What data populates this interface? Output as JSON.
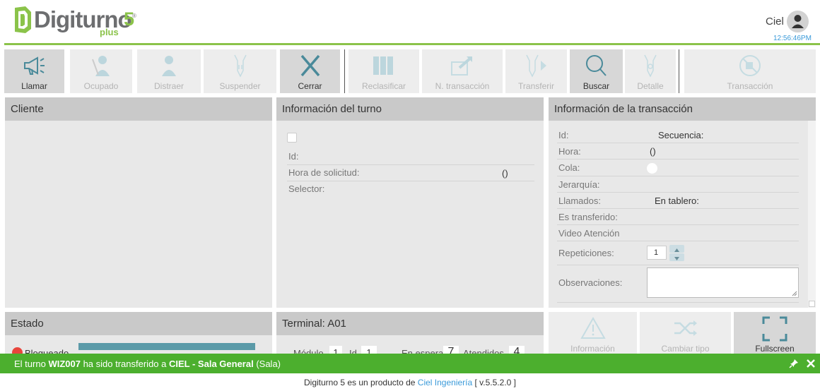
{
  "header": {
    "logo_word": "Digiturno",
    "logo_number": "5",
    "logo_reg": "®",
    "logo_plus": "plus",
    "user_name": "Ciel",
    "clock": "12:56:46PM"
  },
  "toolbar": [
    {
      "label": "Llamar",
      "icon": "megaphone-icon",
      "enabled": true
    },
    {
      "label": "Ocupado",
      "icon": "busy-user-icon",
      "enabled": false
    },
    {
      "label": "Distraer",
      "icon": "user-icon",
      "enabled": false
    },
    {
      "label": "Suspender",
      "icon": "pause-tag-icon",
      "enabled": false
    },
    {
      "label": "Cerrar",
      "icon": "close-icon",
      "enabled": true
    },
    {
      "label": "Reclasificar",
      "icon": "binders-icon",
      "enabled": false
    },
    {
      "label": "N. transacción",
      "icon": "export-icon",
      "enabled": false
    },
    {
      "label": "Transferir",
      "icon": "transfer-tag-icon",
      "enabled": false
    },
    {
      "label": "Buscar",
      "icon": "search-icon",
      "enabled": true
    },
    {
      "label": "Detalle",
      "icon": "detail-tag-icon",
      "enabled": false
    },
    {
      "label": "Transacción",
      "icon": "no-transaction-icon",
      "enabled": false
    }
  ],
  "cliente": {
    "title": "Cliente"
  },
  "turno": {
    "title": "Información del turno",
    "id_label": "Id:",
    "hora_label": "Hora de solicitud:",
    "hora_value": "()",
    "selector_label": "Selector:"
  },
  "transaccion": {
    "title": "Información de la transacción",
    "id_label": "Id:",
    "secuencia_label": "Secuencia:",
    "hora_label": "Hora:",
    "hora_value": "()",
    "cola_label": "Cola:",
    "jerarquia_label": "Jerarquía:",
    "llamados_label": "Llamados:",
    "tablero_label": "En tablero:",
    "transferido_label": "Es transferido:",
    "video_label": "Video Atención",
    "repeticiones_label": "Repeticiones:",
    "repeticiones_value": "1",
    "observaciones_label": "Observaciones:"
  },
  "estado": {
    "title": "Estado",
    "status": "Bloqueado",
    "status_color": "#e8453c"
  },
  "terminal": {
    "title": "Terminal: A01",
    "modulo_label": "Módulo",
    "modulo_value": "1",
    "id_label": "Id",
    "id_value": "1",
    "espera_label": "En espera",
    "espera_value": "7",
    "atendidos_label": "Atendidos",
    "atendidos_value": "4"
  },
  "bottom_buttons": [
    {
      "label": "Información",
      "icon": "warning-icon",
      "enabled": false
    },
    {
      "label": "Cambiar tipo",
      "icon": "shuffle-icon",
      "enabled": false
    },
    {
      "label": "Fullscreen",
      "icon": "fullscreen-icon",
      "enabled": true
    }
  ],
  "notification": {
    "prefix": "El turno",
    "turno": "WIZ007",
    "middle": "ha sido transferido a",
    "destino": "CIEL - Sala General",
    "suffix": "(Sala)"
  },
  "footer": {
    "text": "Digiturno 5 es un producto de",
    "link": "Ciel Ingeniería",
    "version": "[ v.5.5.2.0 ]"
  },
  "colors": {
    "brand_green": "#8bc34a",
    "notif_green": "#4caf2e",
    "teal": "#5b9aa8",
    "link_blue": "#3a9ad9"
  }
}
